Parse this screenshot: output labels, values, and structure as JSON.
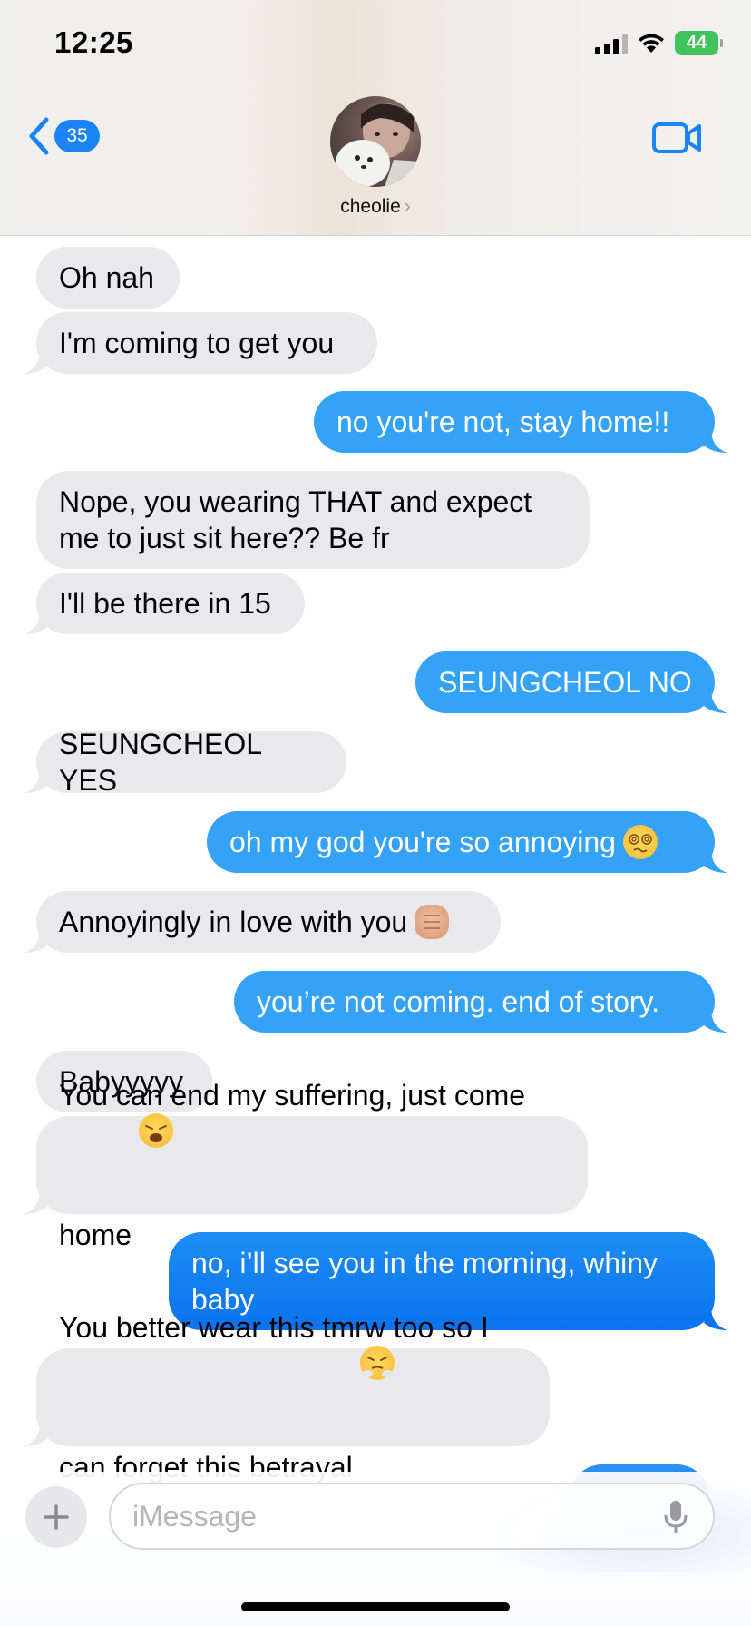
{
  "status_bar": {
    "time": "12:25",
    "battery": "44"
  },
  "nav": {
    "back_count": "35",
    "contact_name": "cheolie",
    "contact_chevron": "›"
  },
  "messages": [
    {
      "side": "received",
      "text": "Oh nah"
    },
    {
      "side": "received",
      "text": "I'm coming to get you"
    },
    {
      "side": "sent",
      "text": "no you're not, stay home!!"
    },
    {
      "side": "received",
      "text": "Nope, you wearing THAT and expect me to just sit here?? Be fr"
    },
    {
      "side": "received",
      "text": "I'll be there in 15"
    },
    {
      "side": "sent",
      "text": "SEUNGCHEOL NO"
    },
    {
      "side": "received",
      "text": "SEUNGCHEOL YES"
    },
    {
      "side": "sent",
      "text": "oh my god you're so annoying",
      "emoji": "face-with-spiral-eyes"
    },
    {
      "side": "received",
      "text": "Annoyingly in love with you",
      "emoji": "oncoming-fist"
    },
    {
      "side": "sent",
      "text": "you’re not coming. end of story."
    },
    {
      "side": "received",
      "text": "Babyyyyy"
    },
    {
      "side": "received",
      "text": "You can end my suffering, just come home",
      "emoji": "weary-face"
    },
    {
      "side": "sent",
      "text": "no, i’ll see you in the morning, whiny baby"
    },
    {
      "side": "received",
      "text": "You better wear this tmrw too so I can forget this betrayal",
      "emoji": "face-with-steam"
    }
  ],
  "composer": {
    "placeholder": "iMessage"
  },
  "colors": {
    "sent_bubble": "#34a2f6",
    "received_bubble": "#e9e9eb",
    "accent": "#1a84f5",
    "battery": "#3fc35a"
  },
  "icons": {
    "back": "chevron-left-icon",
    "video": "video-camera-icon",
    "plus": "plus-icon",
    "mic": "microphone-icon",
    "signal": "cellular-signal-icon",
    "wifi": "wifi-icon",
    "battery": "battery-icon"
  }
}
